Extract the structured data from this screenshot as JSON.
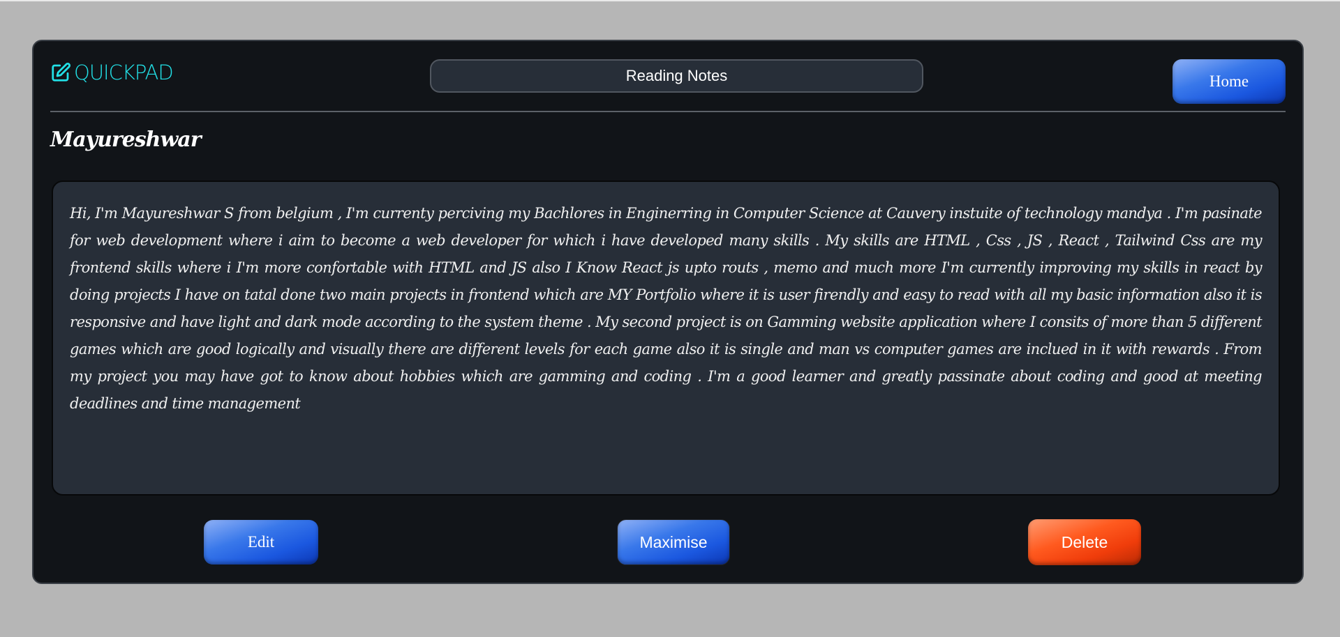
{
  "app": {
    "brand": "QUICKPAD",
    "brand_color": "#22e0e6",
    "logo_icon": "edit-note-icon"
  },
  "note": {
    "title_value": "Reading Notes",
    "author": "Mayureshwar",
    "content": "Hi, I'm Mayureshwar S from belgium , I'm currenty perciving my Bachlores in Enginerring in Computer Science at Cauvery instuite of technology mandya . I'm pasinate for web development where i aim to become a web developer for which i have developed many skills . My skills are HTML , Css , JS , React , Tailwind Css are my frontend skills where i I'm more confortable with HTML and JS also I Know React js upto routs , memo and much more I'm currently improving my skills in react by doing projects I have on tatal done two main projects in frontend which are MY Portfolio where it is user firendly and easy to read with all my basic information also it is responsive and have light and dark mode according to the system theme . My second project is on Gamming website application where I consits of more than 5 different games which are good logically and visually there are different levels for each game also it is single and man vs  computer games are inclued in it with rewards . From my project you may have got to know about hobbies which are gamming and coding . I'm a good learner and greatly passinate about coding and good at meeting deadlines and time management"
  },
  "nav": {
    "home_label": "Home"
  },
  "actions": {
    "edit_label": "Edit",
    "maximise_label": "Maximise",
    "delete_label": "Delete"
  },
  "colors": {
    "page_bg": "#b6b6b6",
    "card_bg": "#111418",
    "field_bg": "#272e38",
    "primary_blue": "#1b58e0",
    "danger_red": "#f03d0b"
  }
}
